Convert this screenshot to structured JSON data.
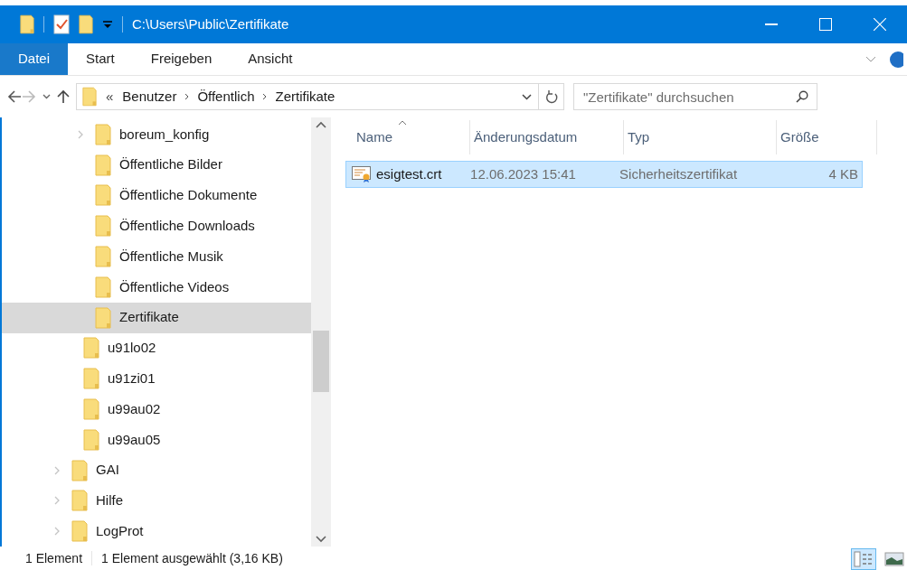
{
  "window": {
    "title": "C:\\Users\\Public\\Zertifikate"
  },
  "ribbon_tabs": [
    {
      "label": "Datei",
      "selected": true
    },
    {
      "label": "Start",
      "selected": false
    },
    {
      "label": "Freigeben",
      "selected": false
    },
    {
      "label": "Ansicht",
      "selected": false
    }
  ],
  "address_bar": {
    "overflow": "«",
    "crumbs": [
      "Benutzer",
      "Öffentlich",
      "Zertifikate"
    ]
  },
  "search": {
    "placeholder": "\"Zertifikate\" durchsuchen"
  },
  "tree": {
    "children": [
      {
        "children": [
          {
            "children": [
              {
                "label": "boreum_konfig",
                "has_children": true,
                "selected": false
              },
              {
                "label": "Öffentliche Bilder",
                "has_children": false,
                "selected": false
              },
              {
                "label": "Öffentliche Dokumente",
                "has_children": false,
                "selected": false
              },
              {
                "label": "Öffentliche Downloads",
                "has_children": false,
                "selected": false
              },
              {
                "label": "Öffentliche Musik",
                "has_children": false,
                "selected": false
              },
              {
                "label": "Öffentliche Videos",
                "has_children": false,
                "selected": false
              },
              {
                "label": "Zertifikate",
                "has_children": false,
                "selected": true
              }
            ]
          },
          {
            "label": "u91lo02",
            "has_children": false,
            "selected": false
          },
          {
            "label": "u91zi01",
            "has_children": false,
            "selected": false
          },
          {
            "label": "u99au02",
            "has_children": false,
            "selected": false
          },
          {
            "label": "u99au05",
            "has_children": false,
            "selected": false
          }
        ]
      },
      {
        "label": "GAI",
        "has_children": true,
        "selected": false
      },
      {
        "label": "Hilfe",
        "has_children": true,
        "selected": false
      },
      {
        "label": "LogProt",
        "has_children": true,
        "selected": false
      }
    ]
  },
  "file_list": {
    "columns": [
      "Name",
      "Änderungsdatum",
      "Typ",
      "Größe"
    ],
    "rows": [
      {
        "cells": [
          "esigtest.crt",
          "12.06.2023 15:41",
          "Sicherheitszertifikat",
          "4 KB"
        ],
        "selected": true
      }
    ]
  },
  "status_bar": {
    "items": [
      "1 Element",
      "1 Element ausgewählt (3,16 KB)"
    ]
  },
  "view_buttons": [
    {
      "kind": "details",
      "selected": true
    },
    {
      "kind": "tiles",
      "selected": false
    }
  ]
}
